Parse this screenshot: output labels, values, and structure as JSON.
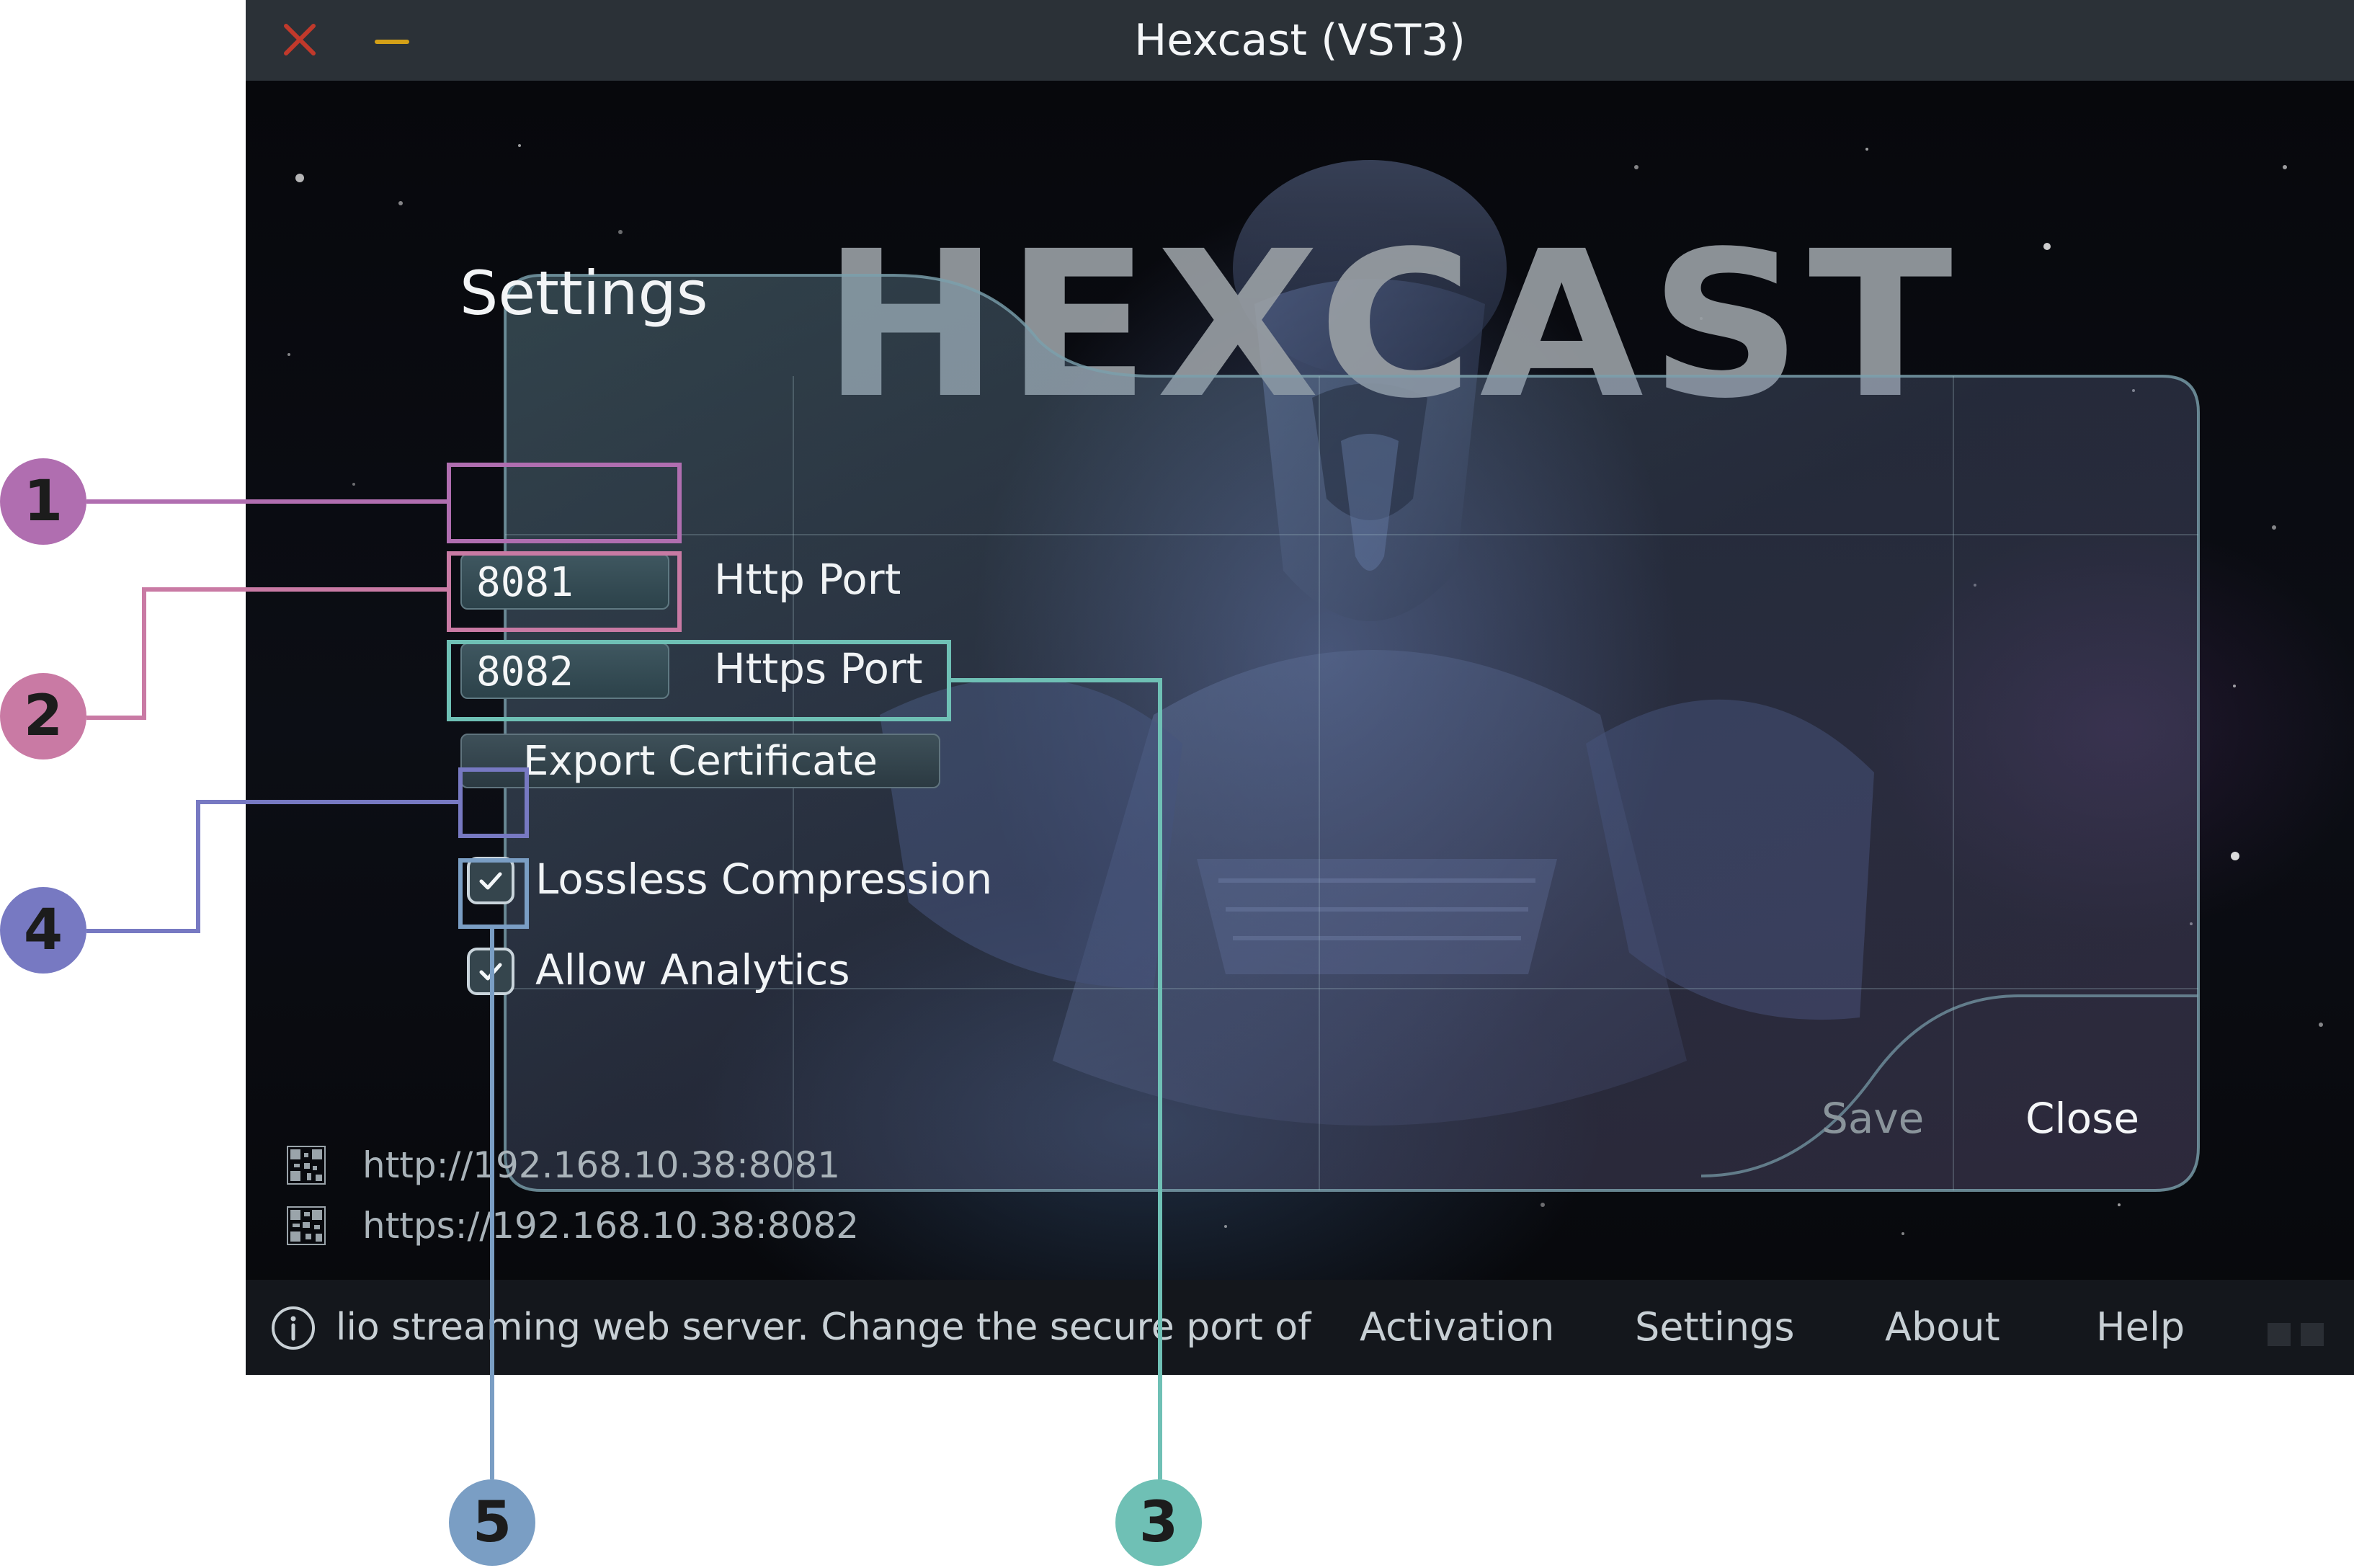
{
  "window": {
    "title": "Hexcast (VST3)",
    "close_icon": "close-x-icon",
    "minimize_icon": "minimize-icon"
  },
  "brand": {
    "logo_text": "HEXCAST"
  },
  "settings": {
    "title": "Settings",
    "http_port_value": "8081",
    "http_port_label": "Http Port",
    "https_port_value": "8082",
    "https_port_label": "Https Port",
    "export_certificate_label": "Export Certificate",
    "lossless_compression_label": "Lossless Compression",
    "lossless_compression_checked": true,
    "allow_analytics_label": "Allow Analytics",
    "allow_analytics_checked": true,
    "save_label": "Save",
    "close_label": "Close"
  },
  "server": {
    "http_url": "http://192.168.10.38:8081",
    "https_url": "https://192.168.10.38:8082"
  },
  "statusbar": {
    "status_text": "lio streaming web server.   Change the secure port of",
    "nav": [
      "Activation",
      "Settings",
      "About",
      "Help"
    ]
  },
  "callouts": [
    "1",
    "2",
    "3",
    "4",
    "5"
  ],
  "colors": {
    "callout_1": "#b06eb0",
    "callout_2": "#c97aa4",
    "callout_3": "#6fc0b5",
    "callout_4": "#7779c2",
    "callout_5": "#7a9ec4",
    "close_x": "#c0392b",
    "minimize": "#d4a017"
  }
}
